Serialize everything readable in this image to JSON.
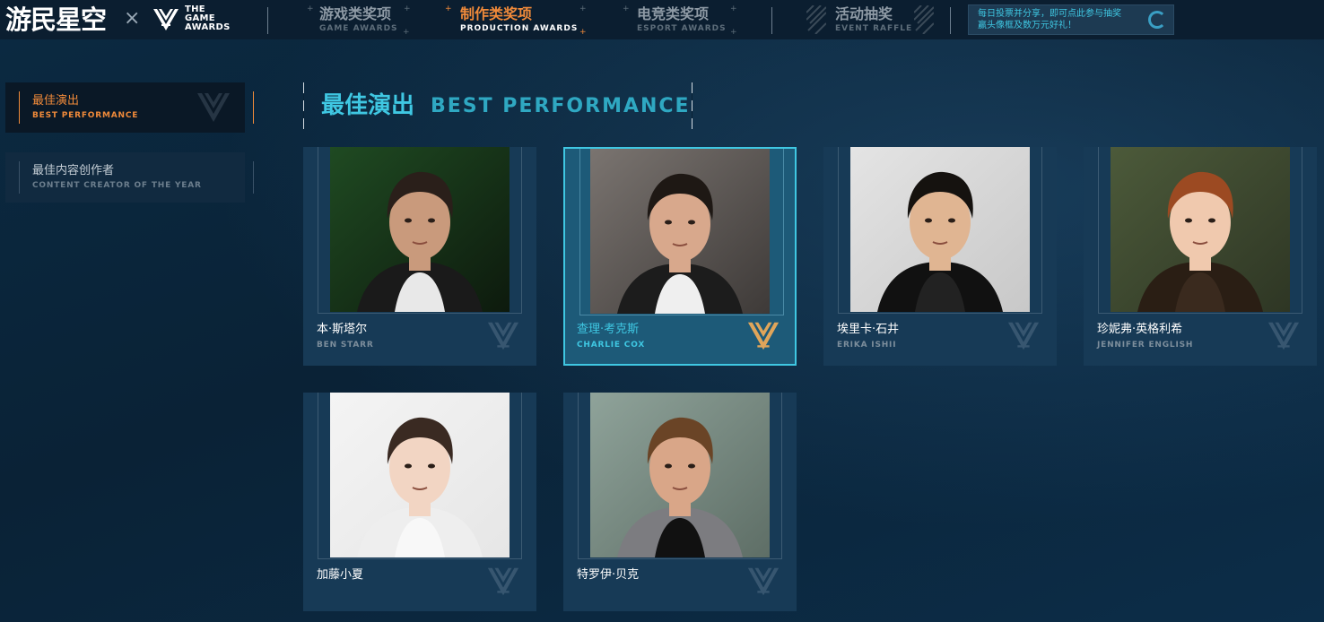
{
  "header": {
    "logo": "游民星空",
    "times": "×",
    "tga_lines": [
      "THE",
      "GAME",
      "AWARDS"
    ],
    "nav": [
      {
        "cn": "游戏类奖项",
        "en": "GAME AWARDS",
        "active": false
      },
      {
        "cn": "制作类奖项",
        "en": "PRODUCTION AWARDS",
        "active": true
      },
      {
        "cn": "电竞类奖项",
        "en": "ESPORT AWARDS",
        "active": false
      },
      {
        "cn": "活动抽奖",
        "en": "EVENT RAFFLE",
        "active": false
      }
    ],
    "promo_lines": [
      "每日投票并分享，即可点此参与抽奖",
      "赢头像框及数万元好礼！"
    ]
  },
  "sidebar": {
    "items": [
      {
        "cn": "最佳演出",
        "en": "BEST PERFORMANCE",
        "active": true
      },
      {
        "cn": "最佳内容创作者",
        "en": "CONTENT CREATOR OF THE YEAR",
        "active": false
      }
    ]
  },
  "section": {
    "title_cn": "最佳演出",
    "title_en": "BEST PERFORMANCE"
  },
  "nominees": [
    {
      "cn": "本·斯塔尔",
      "en": "BEN STARR",
      "selected": false,
      "bg": [
        "#1f4a22",
        "#0d1a0d"
      ],
      "skin": "#c99a7c",
      "hair": "#2a1f1a",
      "shirt": "#e8e8e8",
      "jacket": "#1a1a1a"
    },
    {
      "cn": "查理·考克斯",
      "en": "CHARLIE COX",
      "selected": true,
      "bg": [
        "#7a7470",
        "#3e3a38"
      ],
      "skin": "#d8a88c",
      "hair": "#1e1814",
      "shirt": "#efefef",
      "jacket": "#1c1c1c"
    },
    {
      "cn": "埃里卡·石井",
      "en": "ERIKA ISHII",
      "selected": false,
      "bg": [
        "#e4e4e4",
        "#c8c8c8"
      ],
      "skin": "#e0b592",
      "hair": "#15120f",
      "shirt": "#222222",
      "jacket": "#111111"
    },
    {
      "cn": "珍妮弗·英格利希",
      "en": "JENNIFER ENGLISH",
      "selected": false,
      "bg": [
        "#4c5a3a",
        "#2e3624"
      ],
      "skin": "#f0c9ae",
      "hair": "#9c4a22",
      "shirt": "#3a2a1e",
      "jacket": "#2a1e14"
    },
    {
      "cn": "加藤小夏",
      "en": "",
      "selected": false,
      "bg": [
        "#f4f4f4",
        "#e6e6e6"
      ],
      "skin": "#f2d5c3",
      "hair": "#3a2a22",
      "shirt": "#f8f8f8",
      "jacket": "#eeeeee"
    },
    {
      "cn": "特罗伊·贝克",
      "en": "",
      "selected": false,
      "bg": [
        "#8fa39a",
        "#5e6e66"
      ],
      "skin": "#d9a688",
      "hair": "#6a4426",
      "shirt": "#111111",
      "jacket": "#7c7c80"
    }
  ],
  "colors": {
    "accent_cyan": "#3fc7e2",
    "accent_orange": "#f08a3a",
    "bg_dark": "#0a2236"
  }
}
